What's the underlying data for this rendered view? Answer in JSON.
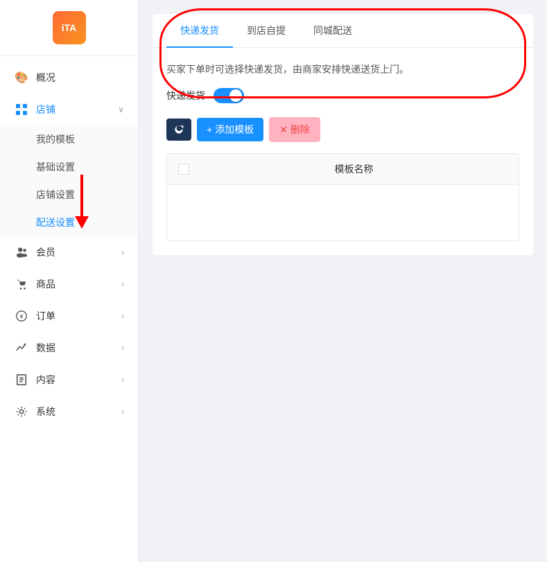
{
  "sidebar": {
    "logo": "iTA",
    "items": [
      {
        "id": "overview",
        "icon": "🎨",
        "label": "概况",
        "hasChildren": false,
        "active": false
      },
      {
        "id": "store",
        "icon": "⊞",
        "label": "店铺",
        "hasChildren": true,
        "active": true,
        "expanded": true
      },
      {
        "id": "member",
        "icon": "👥",
        "label": "会员",
        "hasChildren": true,
        "active": false
      },
      {
        "id": "goods",
        "icon": "🛒",
        "label": "商品",
        "hasChildren": true,
        "active": false
      },
      {
        "id": "order",
        "icon": "💰",
        "label": "订单",
        "hasChildren": true,
        "active": false
      },
      {
        "id": "data",
        "icon": "📈",
        "label": "数据",
        "hasChildren": true,
        "active": false
      },
      {
        "id": "content",
        "icon": "📄",
        "label": "内容",
        "hasChildren": true,
        "active": false
      },
      {
        "id": "system",
        "icon": "⚙",
        "label": "系统",
        "hasChildren": true,
        "active": false
      }
    ],
    "storeSubitems": [
      {
        "id": "mytemplate",
        "label": "我的模板",
        "active": false
      },
      {
        "id": "basicsettings",
        "label": "基础设置",
        "active": false
      },
      {
        "id": "storesettings",
        "label": "店铺设置",
        "active": false
      },
      {
        "id": "deliverysettings",
        "label": "配送设置",
        "active": true
      }
    ]
  },
  "main": {
    "tabs": [
      {
        "id": "express",
        "label": "快递发货",
        "active": true
      },
      {
        "id": "pickup",
        "label": "到店自提",
        "active": false
      },
      {
        "id": "citydelivery",
        "label": "同城配送",
        "active": false
      }
    ],
    "description": "买家下单时可选择快递发货，由商家安排快递送货上门。",
    "toggle_label": "快递发货",
    "toggle_on": true,
    "buttons": {
      "refresh": "↻",
      "add": "+ 添加模板",
      "delete": "✕ 删除"
    },
    "table": {
      "columns": [
        "模板名称"
      ],
      "rows": []
    }
  }
}
